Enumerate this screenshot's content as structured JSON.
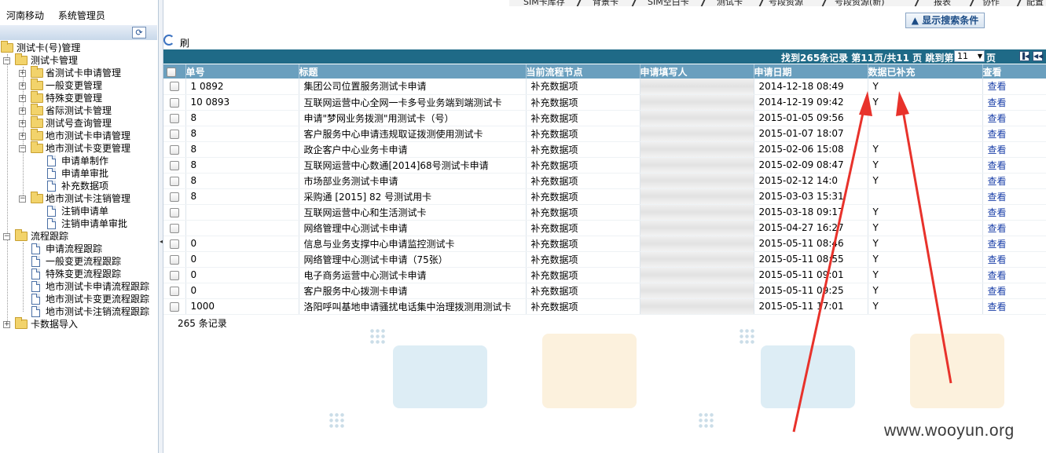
{
  "topnav": {
    "tabs": [
      "SIM卡库存",
      "背景卡",
      "SIM空白卡",
      "测试卡",
      "号段资源",
      "号段资源(新)",
      "报表",
      "协作",
      "配置"
    ]
  },
  "header": {
    "company": "河南移动",
    "user": "系统管理员"
  },
  "sidebar": {
    "collapse_icon": "refresh-icon",
    "tree": {
      "root": "测试卡(号)管理",
      "testcard_mgmt": "测试卡管理",
      "prov_apply": "省测试卡申请管理",
      "general_change": "一般变更管理",
      "special_change": "特殊变更管理",
      "intl_card": "省际测试卡管理",
      "number_query": "测试号查询管理",
      "city_apply": "地市测试卡申请管理",
      "city_change": "地市测试卡变更管理",
      "form_make": "申请单制作",
      "form_review": "申请单审批",
      "supplement": "补充数据项",
      "city_cancel": "地市测试卡注销管理",
      "cancel_form": "注销申请单",
      "cancel_review": "注销申请单审批",
      "flow_track": "流程跟踪",
      "apply_flow": "申请流程跟踪",
      "general_flow": "一般变更流程跟踪",
      "special_flow": "特殊变更流程跟踪",
      "city_apply_flow": "地市测试卡申请流程跟踪",
      "city_change_flow": "地市测试卡变更流程跟踪",
      "city_cancel_flow": "地市测试卡注销流程跟踪",
      "import": "卡数据导入"
    }
  },
  "toolbar": {
    "search_toggle": "▲ 显示搜索条件",
    "refresh": "刷新"
  },
  "pager": {
    "info": "找到265条记录 第11页/共11 页 跳到第",
    "page_value": "11",
    "page_suffix": "页",
    "first_icon": "first-page-icon",
    "prev_icon": "prev-page-icon"
  },
  "table": {
    "columns": [
      "单号",
      "标题",
      "当前流程节点",
      "申请填写人",
      "申请日期",
      "数据已补充",
      "查看"
    ],
    "rows": [
      {
        "id": "1 0892",
        "title": "集团公司位置服务测试卡申请",
        "node": "补充数据项",
        "applicant": "",
        "date": "2014-12-18 08:49",
        "filled": "Y",
        "view": "查看"
      },
      {
        "id": "10 0893",
        "title": "互联网运营中心全网一卡多号业务端到端测试卡",
        "node": "补充数据项",
        "applicant": "",
        "date": "2014-12-19 09:42",
        "filled": "Y",
        "view": "查看"
      },
      {
        "id": "8",
        "title": "申请\"梦网业务拨测\"用测试卡（号）",
        "node": "补充数据项",
        "applicant": "",
        "date": "2015-01-05 09:56",
        "filled": "",
        "view": "查看"
      },
      {
        "id": "8",
        "title": "客户服务中心申请违规取证拨测使用测试卡",
        "node": "补充数据项",
        "applicant": "",
        "date": "2015-01-07 18:07",
        "filled": "",
        "view": "查看"
      },
      {
        "id": "8",
        "title": "政企客户中心业务卡申请",
        "node": "补充数据项",
        "applicant": "",
        "date": "2015-02-06 15:08",
        "filled": "Y",
        "view": "查看"
      },
      {
        "id": "8",
        "title": "互联网运营中心数通[2014]68号测试卡申请",
        "node": "补充数据项",
        "applicant": "",
        "date": "2015-02-09 08:47",
        "filled": "Y",
        "view": "查看"
      },
      {
        "id": "8",
        "title": "市场部业务测试卡申请",
        "node": "补充数据项",
        "applicant": "",
        "date": "2015-02-12 14:0",
        "filled": "Y",
        "view": "查看"
      },
      {
        "id": "8",
        "title": "采购通 [2015] 82 号测试用卡",
        "node": "补充数据项",
        "applicant": "",
        "date": "2015-03-03 15:31",
        "filled": "",
        "view": "查看"
      },
      {
        "id": "",
        "title": "互联网运营中心和生活测试卡",
        "node": "补充数据项",
        "applicant": "",
        "date": "2015-03-18 09:17",
        "filled": "Y",
        "view": "查看"
      },
      {
        "id": "",
        "title": "网络管理中心测试卡申请",
        "node": "补充数据项",
        "applicant": "",
        "date": "2015-04-27 16:27",
        "filled": "Y",
        "view": "查看"
      },
      {
        "id": "0",
        "title": "信息与业务支撑中心申请监控测试卡",
        "node": "补充数据项",
        "applicant": "",
        "date": "2015-05-11 08:46",
        "filled": "Y",
        "view": "查看"
      },
      {
        "id": "0",
        "title": "网络管理中心测试卡申请（75张）",
        "node": "补充数据项",
        "applicant": "",
        "date": "2015-05-11 08:55",
        "filled": "Y",
        "view": "查看"
      },
      {
        "id": "0",
        "title": "电子商务运营中心测试卡申请",
        "node": "补充数据项",
        "applicant": "",
        "date": "2015-05-11 09:01",
        "filled": "Y",
        "view": "查看"
      },
      {
        "id": "0",
        "title": "客户服务中心拨测卡申请",
        "node": "补充数据项",
        "applicant": "",
        "date": "2015-05-11 09:25",
        "filled": "Y",
        "view": "查看"
      },
      {
        "id": "1000",
        "title": "洛阳呼叫基地申请骚扰电话集中治理拨测用测试卡",
        "node": "补充数据项",
        "applicant": "",
        "date": "2015-05-11 17:01",
        "filled": "Y",
        "view": "查看"
      }
    ],
    "footer": "265 条记录"
  },
  "watermark": "www.wooyun.org",
  "colors": {
    "header_bar": "#1f6a87",
    "column_header": "#6a9fbe",
    "link": "#1a3fa8",
    "annotation": "#e8322b"
  }
}
